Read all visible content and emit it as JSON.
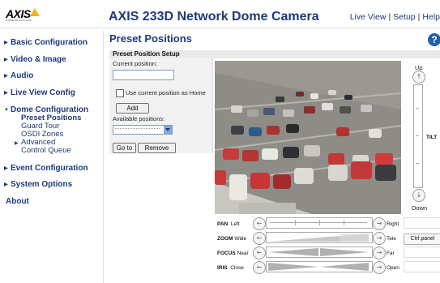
{
  "header": {
    "logo_text": "AXIS",
    "logo_sub": "COMMUNICATIONS",
    "product_title": "AXIS 233D Network Dome Camera",
    "nav": {
      "live_view": "Live View",
      "setup": "Setup",
      "help": "Help",
      "separator": "|"
    }
  },
  "sidebar": {
    "basic": "Basic Configuration",
    "video": "Video & Image",
    "audio": "Audio",
    "live_view_config": "Live View Config",
    "dome": "Dome Configuration",
    "dome_subs": [
      "Preset Positions",
      "Guard Tour",
      "OSDI Zones",
      "Advanced",
      "Control Queue"
    ],
    "event": "Event Configuration",
    "system": "System Options",
    "about": "About"
  },
  "page": {
    "title": "Preset Positions",
    "section_title": "Preset Position Setup",
    "current_position_label": "Current position:",
    "current_position_value": "",
    "home_checkbox_label": "Use current position as Home",
    "add_button": "Add",
    "available_label": "Available positions:",
    "goto_button": "Go to",
    "remove_button": "Remove"
  },
  "ptz": {
    "tilt_up": "Up",
    "tilt_down": "Down",
    "tilt_label": "TILT",
    "rows": [
      {
        "name": "PAN",
        "left": "Left",
        "right": "Right"
      },
      {
        "name": "ZOOM",
        "left": "Wide",
        "right": "Tele"
      },
      {
        "name": "FOCUS",
        "left": "Near",
        "right": "Far"
      },
      {
        "name": "IRIS",
        "left": "Close",
        "right": "Open"
      }
    ],
    "ctrl_panel": "Ctrl panel"
  },
  "colors": {
    "brand_blue": "#1f3a7a",
    "logo_yellow": "#f6b21b"
  }
}
